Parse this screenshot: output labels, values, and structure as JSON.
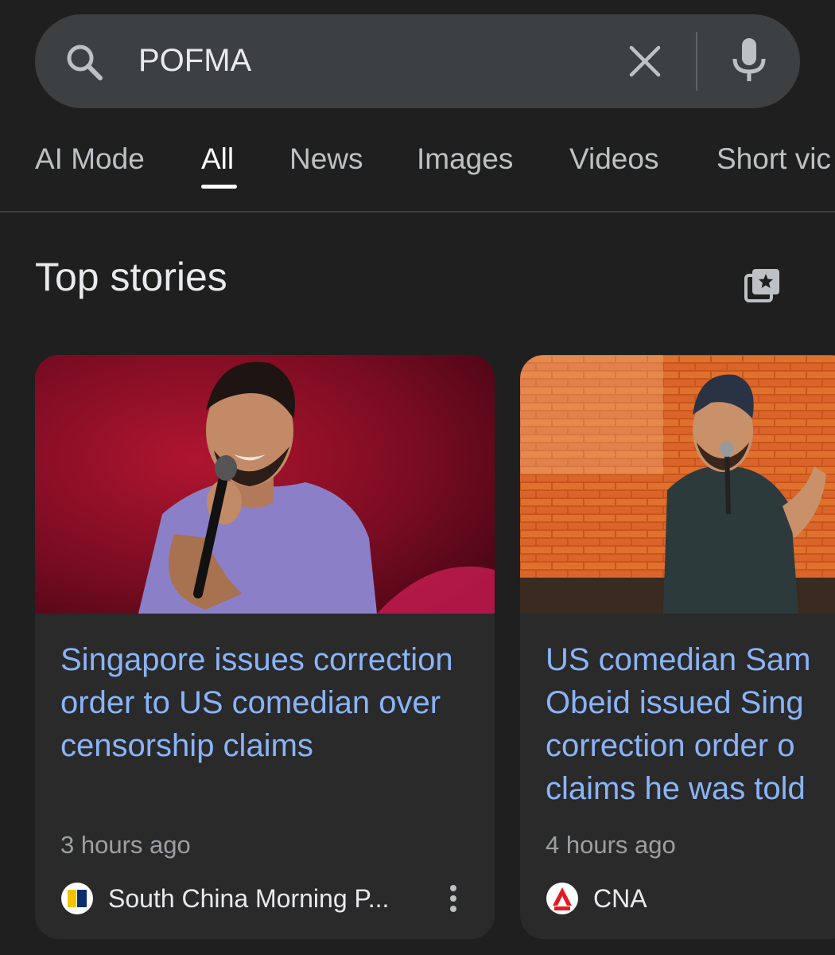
{
  "search": {
    "query": "POFMA"
  },
  "tabs": [
    {
      "label": "AI Mode",
      "active": false
    },
    {
      "label": "All",
      "active": true
    },
    {
      "label": "News",
      "active": false
    },
    {
      "label": "Images",
      "active": false
    },
    {
      "label": "Videos",
      "active": false
    },
    {
      "label": "Short vic",
      "active": false
    }
  ],
  "section": {
    "title": "Top stories"
  },
  "stories": [
    {
      "headline": "Singapore issues correction order to US comedian over censorship claims",
      "time": "3 hours ago",
      "source": "South China Morning P..."
    },
    {
      "headline_lines": [
        "US comedian Sam",
        "Obeid issued Sing",
        "correction order o",
        "claims he was told"
      ],
      "time": "4 hours ago",
      "source": "CNA"
    }
  ],
  "colors": {
    "background": "#1f1f1f",
    "search_bar": "#3c4043",
    "link": "#8ab4f8",
    "card": "#2a2a2b"
  },
  "icons": [
    "search-icon",
    "clear-icon",
    "mic-icon",
    "stories-bookmark-icon",
    "more-vert-icon"
  ]
}
